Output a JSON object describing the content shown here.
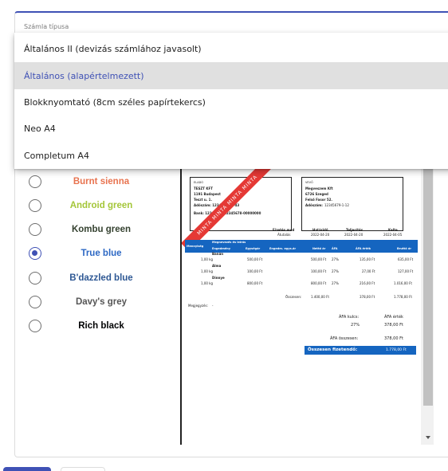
{
  "field": {
    "label": "Számla típusa"
  },
  "invoice_types": [
    {
      "label": "Általános II (devizás számlához javasolt)",
      "selected": false
    },
    {
      "label": "Általános (alapértelmezett)",
      "selected": true
    },
    {
      "label": "Blokknyomtató (8cm széles papírtekercs)",
      "selected": false
    },
    {
      "label": "Neo A4",
      "selected": false
    },
    {
      "label": "Completum A4",
      "selected": false
    }
  ],
  "colors": [
    {
      "name": "Burnt sienna",
      "hex": "#e8734f",
      "checked": false
    },
    {
      "name": "Android green",
      "hex": "#a4c639",
      "checked": false
    },
    {
      "name": "Kombu green",
      "hex": "#354230",
      "checked": false
    },
    {
      "name": "True blue",
      "hex": "#2d68c4",
      "checked": true
    },
    {
      "name": "B'dazzled blue",
      "hex": "#2e5894",
      "checked": false
    },
    {
      "name": "Davy's grey",
      "hex": "#555555",
      "checked": false
    },
    {
      "name": "Rich black",
      "hex": "#010203",
      "checked": false
    }
  ],
  "invoice": {
    "seller_label": "ELADÓ",
    "seller_name": "TESZT KFT",
    "seller_address": "1191 Budapest",
    "seller_street": "Teszt u. 1.",
    "seller_tax": "Adószám: 12345678-2-43",
    "seller_bank": "Bank: 12345678-12345678-00000000",
    "buyer_label": "VEVŐ",
    "buyer_name": "Megveszem Kft",
    "buyer_city": "6726 Szeged",
    "buyer_street": "Felső Fasor 52.",
    "buyer_tax_label": "Adószám:",
    "buyer_tax": "12345679-1-12",
    "watermark": "MINTA MINTA MINTA MINTA",
    "meta_headers": [
      "Fizetés mód",
      "Határidő",
      "Teljesítés",
      "Kelte"
    ],
    "meta_values": [
      "Átutalás",
      "2022-04-20",
      "2022-04-20",
      "2022-04-05"
    ],
    "table_headers": [
      "Mennyiség",
      "Megnevezés és leírás",
      "Egységár",
      "Engedm. egys.ár",
      "Nettó ár",
      "ÁFA",
      "ÁFA érték",
      "Bruttó ár"
    ],
    "table_subheader": "Engedmény",
    "items": [
      {
        "name": "Banán",
        "qty": "1,00 kg",
        "price": "500,00 Ft",
        "net": "500,00 Ft",
        "vat": "27%",
        "vat_value": "135,00 Ft",
        "gross": "635,00 Ft"
      },
      {
        "name": "Alma",
        "qty": "1,00 kg",
        "price": "100,00 Ft",
        "net": "100,00 Ft",
        "vat": "27%",
        "vat_value": "27,00 Ft",
        "gross": "127,00 Ft"
      },
      {
        "name": "Dinnye",
        "qty": "1,00 kg",
        "price": "800,00 Ft",
        "net": "800,00 Ft",
        "vat": "27%",
        "vat_value": "216,00 Ft",
        "gross": "1.016,00 Ft"
      }
    ],
    "total_label": "Összesen:",
    "total_net": "1.400,00 Ft",
    "total_vat": "378,00 Ft",
    "total_gross": "1.778,00 Ft",
    "note_label": "Megjegyzés:",
    "note_value": "-",
    "vat_key_label": "ÁFA kulcs:",
    "vat_value_label": "ÁFA érték",
    "vat_rate": "27%",
    "vat_amount": "378,00 Ft",
    "vat_total_label": "ÁFA összesen:",
    "vat_total": "378,00 Ft",
    "grand_total_label": "Összesen fizetendő:",
    "grand_total": "1.778,00 Ft"
  }
}
